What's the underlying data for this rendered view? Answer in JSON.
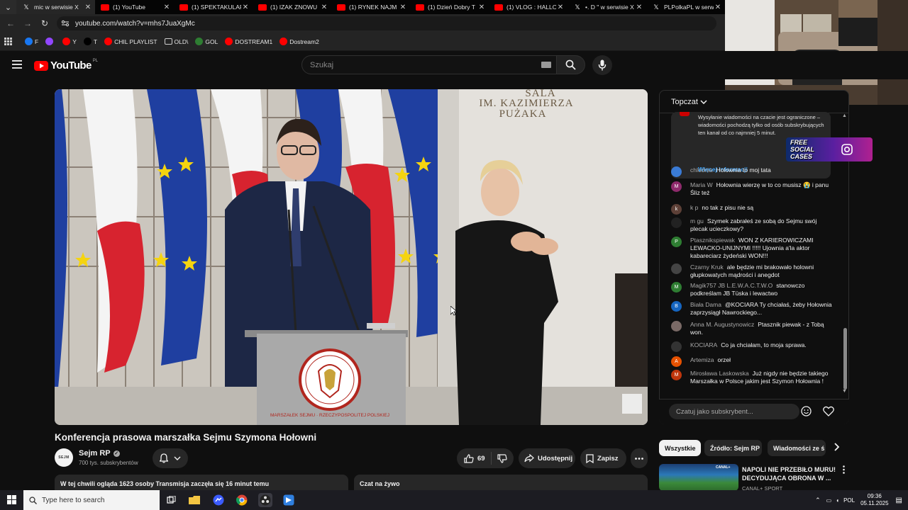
{
  "browser": {
    "tabs": [
      {
        "title": "mic w serwisie X",
        "icon": "x-icon",
        "active": true
      },
      {
        "title": "(1) YouTube",
        "icon": "youtube-icon"
      },
      {
        "title": "(1) SPEKTAKULAR",
        "icon": "youtube-icon"
      },
      {
        "title": "(1) IZAK ZNOWU",
        "icon": "youtube-icon"
      },
      {
        "title": "(1) RYNEK NAJM",
        "icon": "youtube-icon"
      },
      {
        "title": "(1) Dzień Dobry T",
        "icon": "youtube-icon"
      },
      {
        "title": "(1) VLOG : HALLO",
        "icon": "youtube-icon"
      },
      {
        "title": "•. D \" w serwisie X",
        "icon": "x-icon"
      },
      {
        "title": "PLPolkaPL w serw",
        "icon": "x-icon"
      }
    ],
    "url": "youtube.com/watch?v=mhs7JuaXgMc",
    "bookmarks": [
      {
        "label": "F",
        "icon": "facebook-icon",
        "color": "#1877f2"
      },
      {
        "label": "",
        "icon": "twitch-icon",
        "color": "#9146ff"
      },
      {
        "label": "Y",
        "icon": "youtube-icon",
        "color": "#ff0000"
      },
      {
        "label": "T",
        "icon": "x-icon",
        "color": "#000000"
      },
      {
        "label": "CHIL PLAYLIST",
        "icon": "youtube-icon",
        "color": "#ff0000"
      },
      {
        "label": "OLD\\",
        "icon": "folder-icon",
        "color": "#555555"
      },
      {
        "label": "GOL",
        "icon": "gol-icon",
        "color": "#2e7d32"
      },
      {
        "label": "DOSTREAM1",
        "icon": "youtube-icon",
        "color": "#ff0000"
      },
      {
        "label": "Dostream2",
        "icon": "youtube-icon",
        "color": "#ff0000"
      }
    ]
  },
  "youtube": {
    "logo_text": "YouTube",
    "region": "PL",
    "search_placeholder": "Szukaj"
  },
  "video": {
    "title": "Konferencja prasowa marszałka Sejmu Szymona Hołowni",
    "room_sign_1": "SALA",
    "room_sign_2": "IM. KAZIMIERZA",
    "room_sign_3": "PUŻAKA",
    "podium_text": "MARSZAŁEK SEJMU · RZECZYPOSPOLITEJ POLSKIEJ",
    "channel": {
      "name": "Sejm RP",
      "avatar_text": "SEJM",
      "subscribers": "700 tys. subskrybentów"
    },
    "likes": "69",
    "share_label": "Udostępnij",
    "save_label": "Zapisz",
    "description_status": "W tej chwili ogląda 1623 osoby  Transmisja zaczęła się 16 minut temu",
    "live_chat_label": "Czat na żywo"
  },
  "chat": {
    "mode": "Topczat",
    "notice_text": "Wysyłanie wiadomości na czacie jest ograniczone – wiadomości pochodzą tylko od osób subskrybujących ten kanał od co najmniej 5 minut.",
    "notice_link": "Więcej informacji",
    "badge_text_1": "FREE",
    "badge_text_2": "SOCIAL",
    "badge_text_3": "CASES",
    "messages": [
      {
        "author": "chlodnia",
        "text": "Holownia to moj tata",
        "initial": "",
        "color": "#3a7bd5"
      },
      {
        "author": "Maria W",
        "text": "Hołownia wierzę w to co musisz 😭 i panu Śliz też",
        "initial": "M",
        "color": "#8e2a6b"
      },
      {
        "author": "k p",
        "text": "no tak z pisu nie są",
        "initial": "k",
        "color": "#5d4037"
      },
      {
        "author": "m gu",
        "text": "Szymek zabrałeś ze sobą do Sejmu swój plecak ucieczkowy?",
        "initial": "",
        "color": "#222222"
      },
      {
        "author": "Ptasznikspiewak",
        "text": "WON Z KARIEROWICZAMI LEWACKO-UNIJNYMI !!!!! Ujownia a'la aktor kabareciarz żydeński WON!!!",
        "initial": "P",
        "color": "#2e7d32"
      },
      {
        "author": "Czarny Kruk",
        "text": "ale będzie mi brakowało holowni głupkowatych mądrości i anegdot",
        "initial": "",
        "color": "#444444"
      },
      {
        "author": "Magik757 JB L.E.W.A.C.T.W.O",
        "text": "stanowczo podkreślam JB Tüska i lewactwo",
        "initial": "M",
        "color": "#2e7d32"
      },
      {
        "author": "Biała Dama",
        "text": "@KOCIARA Ty chciałaś, żeby Hołownia zaprzysiągł Nawrockiego...",
        "initial": "B",
        "color": "#1565c0"
      },
      {
        "author": "Anna M. Augustynowicz",
        "text": "Ptasznik piewak - z Tobą won.",
        "initial": "",
        "color": "#7a6a66"
      },
      {
        "author": "KOCIARA",
        "text": "Co ja chciałam, to moja sprawa.",
        "initial": "",
        "color": "#333333"
      },
      {
        "author": "Artemiza",
        "text": "orzeł",
        "initial": "A",
        "color": "#e65100"
      },
      {
        "author": "Mirosława Laskowska",
        "text": "Już nigdy nie będzie takiego Marszałka w Polsce jakim jest Szymon Hołownia !",
        "initial": "M",
        "color": "#bf360c"
      }
    ],
    "input_placeholder": "Czatuj jako subskrybent..."
  },
  "recommendations": {
    "chips": [
      {
        "label": "Wszystkie",
        "active": true
      },
      {
        "label": "Źródło: Sejm RP"
      },
      {
        "label": "Wiadomości ze ś"
      }
    ],
    "card": {
      "title": "NAPOLI NIE PRZEBIŁO MURU! DECYDUJĄCA OBRONA W ...",
      "channel": "CANAL+ SPORT",
      "thumb_label": "CANAL+"
    }
  },
  "taskbar": {
    "search_placeholder": "Type here to search",
    "language": "POL",
    "time": "09:36",
    "date": "05.11.2025"
  }
}
